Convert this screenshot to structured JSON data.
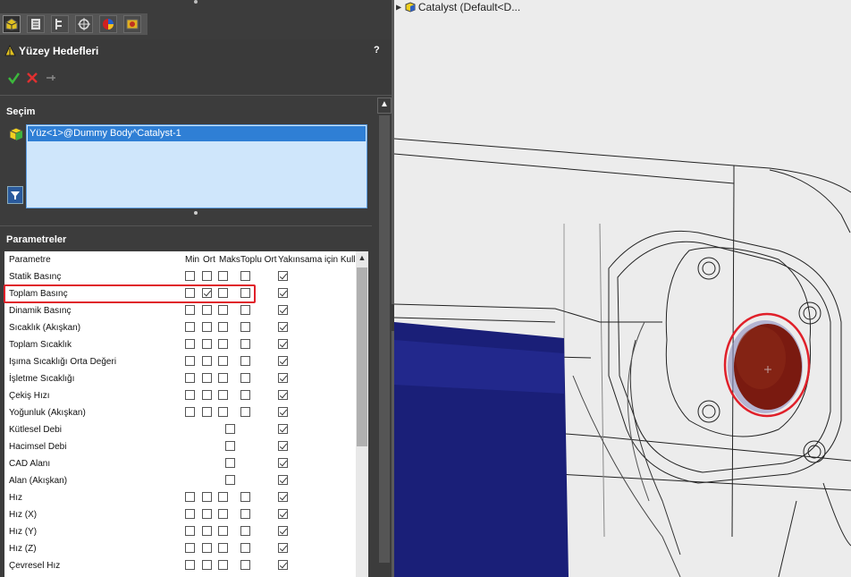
{
  "panel": {
    "title": "Yüzey Hedefleri",
    "help": "?",
    "tabs": [
      "feature-manager-icon",
      "property-manager-icon",
      "configuration-manager-icon",
      "dimxpert-icon",
      "display-manager-icon",
      "flow-analysis-icon"
    ],
    "selection": {
      "header": "Seçim",
      "item": "Yüz<1>@Dummy Body^Catalyst-1"
    },
    "parameters": {
      "header": "Parametreler",
      "columns": {
        "name": "Parametre",
        "min": "Min",
        "avg": "Ort",
        "max": "Maks",
        "bulk_avg": "Toplu Ort",
        "convergence": "Yakınsama için Kullan"
      },
      "rows": [
        {
          "name": "Statik Basınç",
          "min": false,
          "avg": false,
          "max": false,
          "bulk": false,
          "conv": true,
          "has_mm": true
        },
        {
          "name": "Toplam Basınç",
          "min": false,
          "avg": true,
          "max": false,
          "bulk": false,
          "conv": true,
          "has_mm": true
        },
        {
          "name": "Dinamik Basınç",
          "min": false,
          "avg": false,
          "max": false,
          "bulk": false,
          "conv": true,
          "has_mm": true
        },
        {
          "name": "Sıcaklık (Akışkan)",
          "min": false,
          "avg": false,
          "max": false,
          "bulk": false,
          "conv": true,
          "has_mm": true
        },
        {
          "name": "Toplam Sıcaklık",
          "min": false,
          "avg": false,
          "max": false,
          "bulk": false,
          "conv": true,
          "has_mm": true
        },
        {
          "name": "Işıma Sıcaklığı Orta Değeri",
          "min": false,
          "avg": false,
          "max": false,
          "bulk": false,
          "conv": true,
          "has_mm": true
        },
        {
          "name": "İşletme Sıcaklığı",
          "min": false,
          "avg": false,
          "max": false,
          "bulk": false,
          "conv": true,
          "has_mm": true
        },
        {
          "name": "Çekiş Hızı",
          "min": false,
          "avg": false,
          "max": false,
          "bulk": false,
          "conv": true,
          "has_mm": true
        },
        {
          "name": "Yoğunluk (Akışkan)",
          "min": false,
          "avg": false,
          "max": false,
          "bulk": false,
          "conv": true,
          "has_mm": true
        },
        {
          "name": "Kütlesel Debi",
          "min": null,
          "avg": null,
          "max": false,
          "bulk": null,
          "conv": true,
          "has_mm": false
        },
        {
          "name": "Hacimsel Debi",
          "min": null,
          "avg": null,
          "max": false,
          "bulk": null,
          "conv": true,
          "has_mm": false
        },
        {
          "name": "CAD Alanı",
          "min": null,
          "avg": null,
          "max": false,
          "bulk": null,
          "conv": true,
          "has_mm": false
        },
        {
          "name": "Alan (Akışkan)",
          "min": null,
          "avg": null,
          "max": false,
          "bulk": null,
          "conv": true,
          "has_mm": false
        },
        {
          "name": "Hız",
          "min": false,
          "avg": false,
          "max": false,
          "bulk": false,
          "conv": true,
          "has_mm": true
        },
        {
          "name": "Hız (X)",
          "min": false,
          "avg": false,
          "max": false,
          "bulk": false,
          "conv": true,
          "has_mm": true
        },
        {
          "name": "Hız (Y)",
          "min": false,
          "avg": false,
          "max": false,
          "bulk": false,
          "conv": true,
          "has_mm": true
        },
        {
          "name": "Hız (Z)",
          "min": false,
          "avg": false,
          "max": false,
          "bulk": false,
          "conv": true,
          "has_mm": true
        },
        {
          "name": "Çevresel Hız",
          "min": false,
          "avg": false,
          "max": false,
          "bulk": false,
          "conv": true,
          "has_mm": true
        }
      ]
    }
  },
  "viewport": {
    "tree_label": "Catalyst  (Default<D...",
    "highlight_color": "#e0202a",
    "face_color": "#7a1a10",
    "body_color": "#1a1f78"
  }
}
